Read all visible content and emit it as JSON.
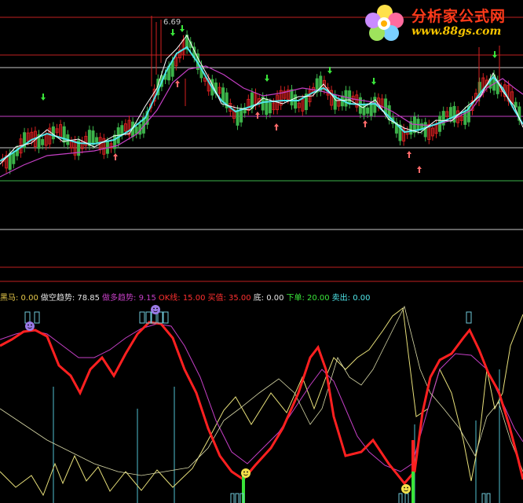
{
  "price_panel": {
    "high_label": "6.69",
    "colors": {
      "up": "#d32020",
      "down": "#3cb34a",
      "ma_fast": "#ffffff",
      "ma_mid": "#4fe6ea",
      "ma_slow": "#c53fc5"
    }
  },
  "indicator_panel": {
    "legend": [
      {
        "label": "黑马:",
        "value": "0.00",
        "color": "#e6c84a"
      },
      {
        "label": "做空趋势:",
        "value": "78.85",
        "color": "#e6e6e6"
      },
      {
        "label": "做多趋势:",
        "value": "9.15",
        "color": "#c53fc5"
      },
      {
        "label": "OK线:",
        "value": "15.00",
        "color": "#ff3030"
      },
      {
        "label": "买值:",
        "value": "35.00",
        "color": "#ff3030"
      },
      {
        "label": "底:",
        "value": "0.00",
        "color": "#e6e6e6"
      },
      {
        "label": "下单:",
        "value": "20.00",
        "color": "#3ae53a"
      },
      {
        "label": "卖出:",
        "value": "0.00",
        "color": "#4fe6ea"
      }
    ]
  },
  "watermark": {
    "title": "分析家公式网",
    "url": "www.88gs.com"
  }
}
